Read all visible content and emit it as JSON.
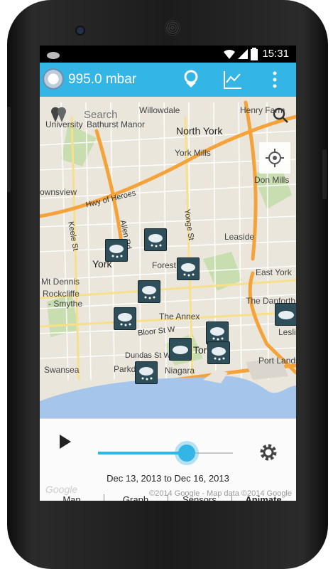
{
  "status": {
    "time": "15:31"
  },
  "appbar": {
    "title": "995.0 mbar"
  },
  "search": {
    "placeholder": "Search"
  },
  "map": {
    "labels": {
      "willowdale": "Willowdale",
      "henry_farm": "Henry Farm",
      "university": "University",
      "bathurst_manor": "Bathurst Manor",
      "north_york": "North York",
      "york_mills": "York Mills",
      "don_mills": "Don Mills",
      "ownsview": "ownsview",
      "hwy_of_heroes": "Hwy of Heroes",
      "keele_st": "Keele St",
      "allen_rd": "Allen Rd",
      "yonge_st": "Yonge St",
      "leaside": "Leaside",
      "york": "York",
      "forest_hill": "Forest H",
      "east_york": "East York",
      "mt_dennis": "Mt Dennis",
      "rockcliffe": "Rockcliffe",
      "smythe": "- Smythe",
      "the_danforth": "The Danforth",
      "the_annex": "The Annex",
      "leslieville": "Leslievi",
      "bloor_st": "Bloor St W",
      "dundas_st": "Dundas St W",
      "toronto": "Toronto",
      "port_lands": "Port Lands",
      "swansea": "Swansea",
      "parkdale": "Parkdale",
      "niagara": "Niagara",
      "onto": "onto"
    }
  },
  "controls": {
    "date_range": "Dec 13, 2013 to Dec 16, 2013",
    "progress": 0.66
  },
  "tabs": [
    {
      "label": "Map"
    },
    {
      "label": "Graph"
    },
    {
      "label": "Sensors"
    },
    {
      "label": "Animate"
    }
  ],
  "copyright": "©2014 Google - Map data ©2014 Google",
  "google_logo": "Google",
  "colors": {
    "accent": "#33b5e5",
    "map_bg": "#e9e5dc",
    "highway": "#f4a23a",
    "water": "#a5c5ea"
  }
}
